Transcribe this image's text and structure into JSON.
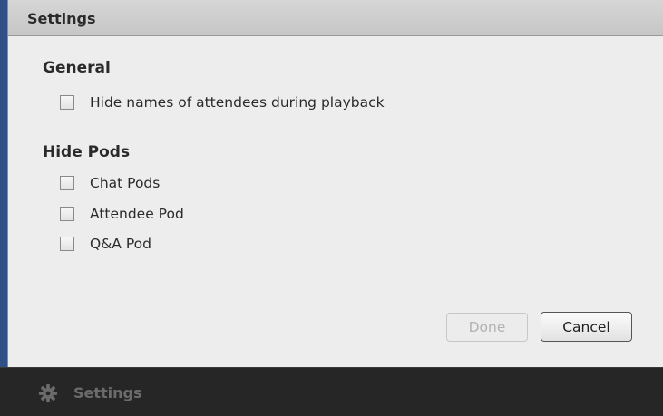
{
  "dialog": {
    "title": "Settings",
    "general": {
      "heading": "General",
      "options": [
        {
          "label": "Hide names of attendees during playback",
          "checked": false
        }
      ]
    },
    "hide_pods": {
      "heading": "Hide Pods",
      "options": [
        {
          "label": "Chat Pods",
          "checked": false
        },
        {
          "label": "Attendee Pod",
          "checked": false
        },
        {
          "label": "Q&A Pod",
          "checked": false
        }
      ]
    },
    "buttons": {
      "done_label": "Done",
      "done_enabled": false,
      "cancel_label": "Cancel"
    }
  },
  "bottombar": {
    "icon": "gear-icon",
    "label": "Settings"
  },
  "colors": {
    "accent_left": "#2f4f86",
    "dialog_bg": "#ededed",
    "titlebar_bg": "#cdcdcd",
    "bottombar_bg": "#262626",
    "disabled_text": "#b2b2b2"
  }
}
